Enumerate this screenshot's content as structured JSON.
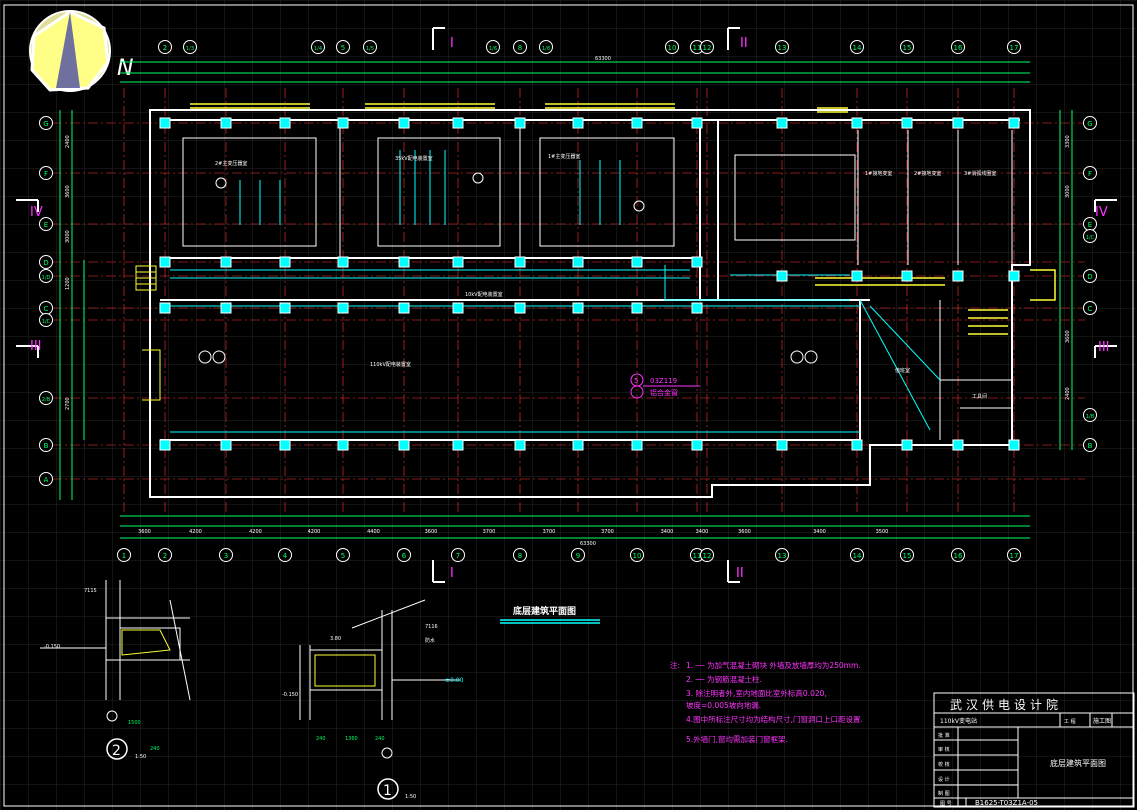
{
  "drawing": {
    "title": "底层建筑平面图",
    "scale_note": "1:50",
    "north_label": "N",
    "colors": {
      "background": "#000000",
      "axis_line": "#ff3333",
      "wall": "#ffffff",
      "dimension": "#00ff66",
      "annotation": "#00ffff",
      "note": "#ff33ff",
      "yellow": "#ffff33",
      "grid": "#2a2a2a"
    }
  },
  "axes": {
    "columns_top": [
      "2",
      "1/3",
      "1/4",
      "5",
      "1/5",
      "1/6",
      "8",
      "1/8",
      "10",
      "11",
      "12",
      "13",
      "14",
      "15",
      "16",
      "17"
    ],
    "columns_bottom": [
      "1",
      "2",
      "3",
      "4",
      "5",
      "6",
      "7",
      "8",
      "9",
      "10",
      "11",
      "12",
      "13",
      "14",
      "15",
      "16",
      "17"
    ],
    "rows_left": [
      "G",
      "F",
      "E",
      "D",
      "1/D",
      "C",
      "1/C",
      "2/B",
      "B",
      "A"
    ],
    "rows_right": [
      "G",
      "F",
      "E",
      "D",
      "C",
      "B",
      "1/B",
      "1/C"
    ]
  },
  "section_marks": [
    "I",
    "II",
    "III",
    "IV"
  ],
  "dimensions": {
    "top_total": "63300",
    "bottom_total": "63300",
    "bottom_segments": [
      "3600",
      "4200",
      "4200",
      "4200",
      "4400",
      "3600",
      "3700",
      "3700",
      "3700",
      "3400",
      "3400",
      "3600",
      "3400",
      "3500"
    ],
    "left_segments": [
      "2400",
      "3600",
      "3000",
      "1200",
      "2700"
    ],
    "right_segments": [
      "3300",
      "3000",
      "3600",
      "2400"
    ]
  },
  "rooms": [
    {
      "name": "110kV配电装置室",
      "label": "2#主变压器室"
    },
    {
      "name": "1#主变压器室"
    },
    {
      "name": "35kV配电装置室"
    },
    {
      "name": "10kV配电装置室"
    },
    {
      "name": "1#接地变室"
    },
    {
      "name": "2#接地变室"
    },
    {
      "name": "3#消弧线圈室"
    },
    {
      "name": "工具间"
    },
    {
      "name": "值班室"
    }
  ],
  "room_callout": {
    "line1": "5",
    "line2": "03Z119",
    "line3": "铝合金窗"
  },
  "detail_1": {
    "number": "1",
    "scale": "1:50",
    "labels": [
      "7116",
      "防水",
      "3.80",
      "±0.00",
      "-0.150",
      "240",
      "1360",
      "240"
    ]
  },
  "detail_2": {
    "number": "2",
    "scale": "1:50",
    "labels": [
      "7115",
      "-0.150",
      "1500",
      "240"
    ]
  },
  "notes": {
    "heading": "注:",
    "items": [
      "1. ── 为加气混凝土砌块    外墙及放墙厚均为250mm.",
      "2. ── 为钢筋混凝土柱.",
      "3. 除注明者外,室内地面比室外标高0.020,",
      "   坡度=0.005坡向地漏.",
      "4.图中所标注尺寸均为结构尺寸,门窗洞口上口距设置.",
      "5.外墙门,窗均需加装门窗框架."
    ]
  },
  "title_block": {
    "institute": "武汉供电设计院",
    "project": "110kV变电站",
    "stage_label": "工 程",
    "stage": "施工图",
    "roles": [
      "批 准",
      "审 核",
      "校 核",
      "设 计",
      "制 图"
    ],
    "drawing_name": "底层建筑平面图",
    "drawing_no_label": "图 号",
    "drawing_no": "B1625-T03Z1A-05"
  }
}
